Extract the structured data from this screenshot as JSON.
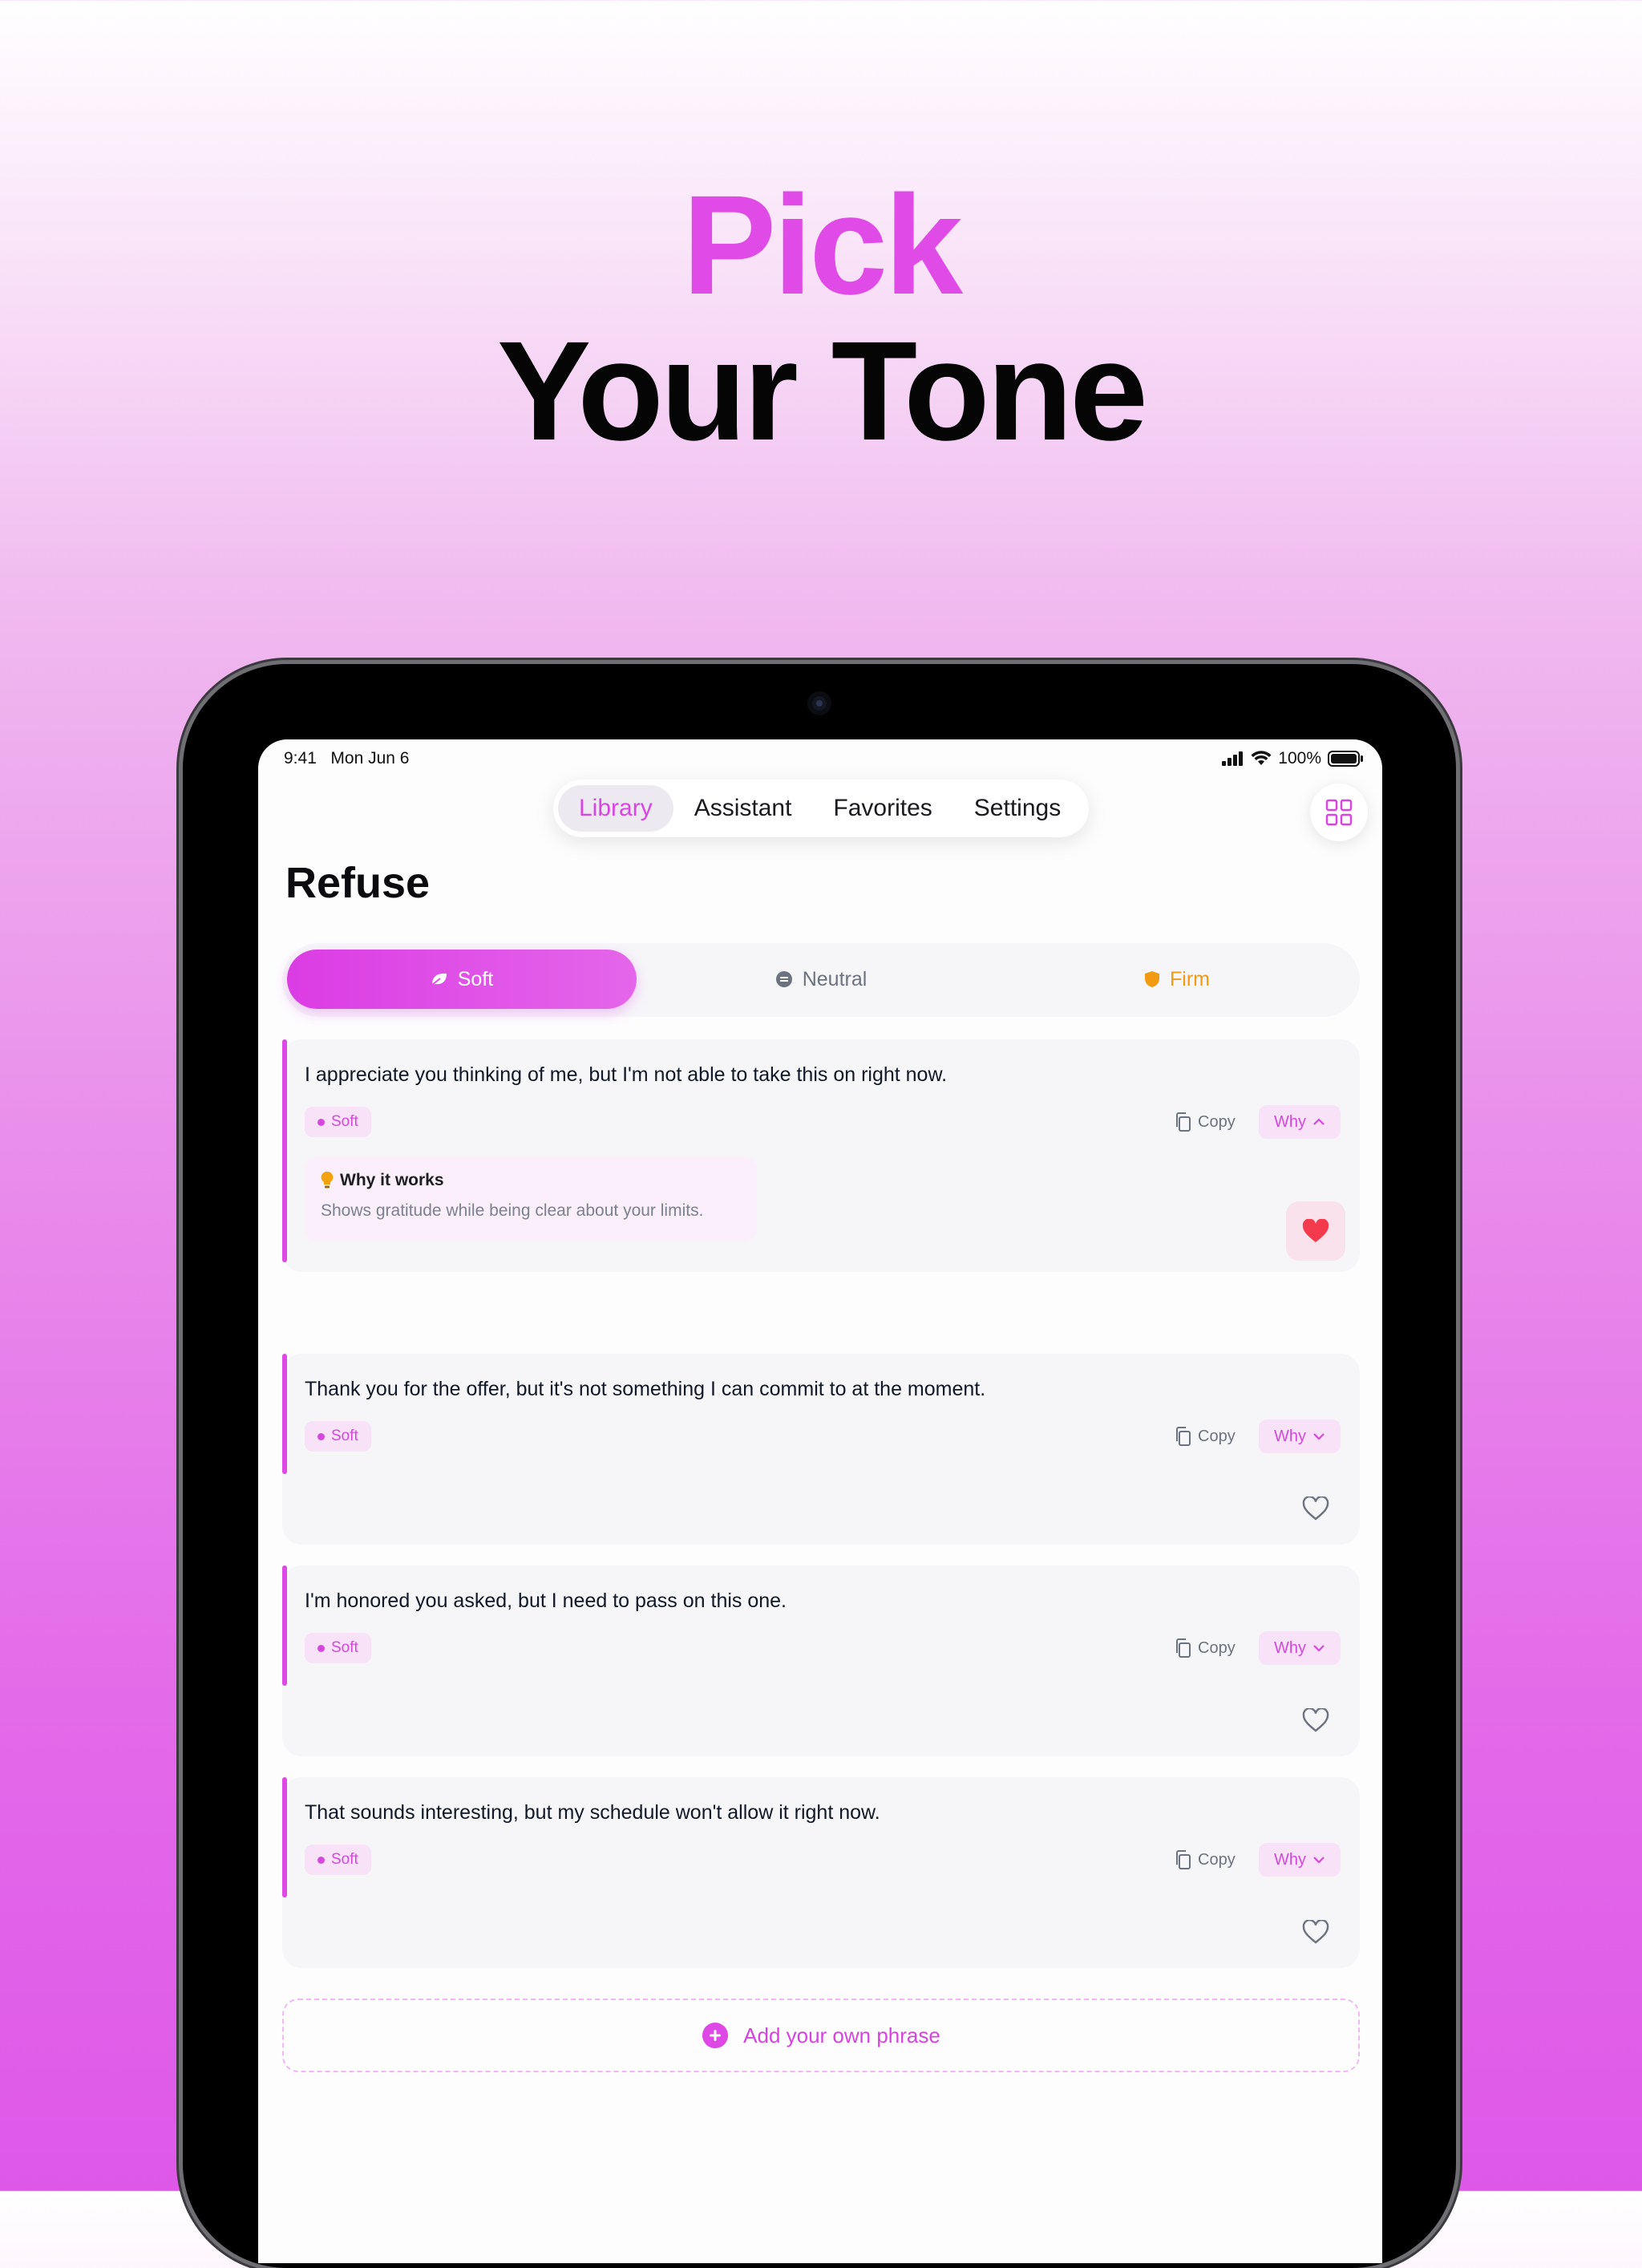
{
  "headline": {
    "line1": "Pick",
    "line2": "Your Tone"
  },
  "status_bar": {
    "time": "9:41",
    "date": "Mon Jun 6",
    "battery": "100%"
  },
  "nav": {
    "tabs": [
      {
        "label": "Library",
        "active": true
      },
      {
        "label": "Assistant",
        "active": false
      },
      {
        "label": "Favorites",
        "active": false
      },
      {
        "label": "Settings",
        "active": false
      }
    ],
    "grid_icon": "grid-icon"
  },
  "page": {
    "title": "Refuse"
  },
  "tones": [
    {
      "label": "Soft",
      "icon": "leaf-icon",
      "selected": true
    },
    {
      "label": "Neutral",
      "icon": "neutral-icon",
      "selected": false
    },
    {
      "label": "Firm",
      "icon": "shield-icon",
      "selected": false
    }
  ],
  "phrases": [
    {
      "text": "I appreciate you thinking of me, but I'm not able to take this on right now.",
      "tone": "Soft",
      "copy_label": "Copy",
      "why_label": "Why",
      "expanded": true,
      "why_title": "Why it works",
      "why_text": "Shows gratitude while being clear about your limits.",
      "favorited": true
    },
    {
      "text": "Thank you for the offer, but it's not something I can commit to at the moment.",
      "tone": "Soft",
      "copy_label": "Copy",
      "why_label": "Why",
      "expanded": false,
      "favorited": false
    },
    {
      "text": "I'm honored you asked, but I need to pass on this one.",
      "tone": "Soft",
      "copy_label": "Copy",
      "why_label": "Why",
      "expanded": false,
      "favorited": false
    },
    {
      "text": "That sounds interesting, but my schedule won't allow it right now.",
      "tone": "Soft",
      "copy_label": "Copy",
      "why_label": "Why",
      "expanded": false,
      "favorited": false
    }
  ],
  "add_phrase": {
    "label": "Add your own phrase"
  },
  "colors": {
    "accent": "#DE48E4",
    "firm": "#F29B12",
    "heart": "#F43B4E"
  }
}
